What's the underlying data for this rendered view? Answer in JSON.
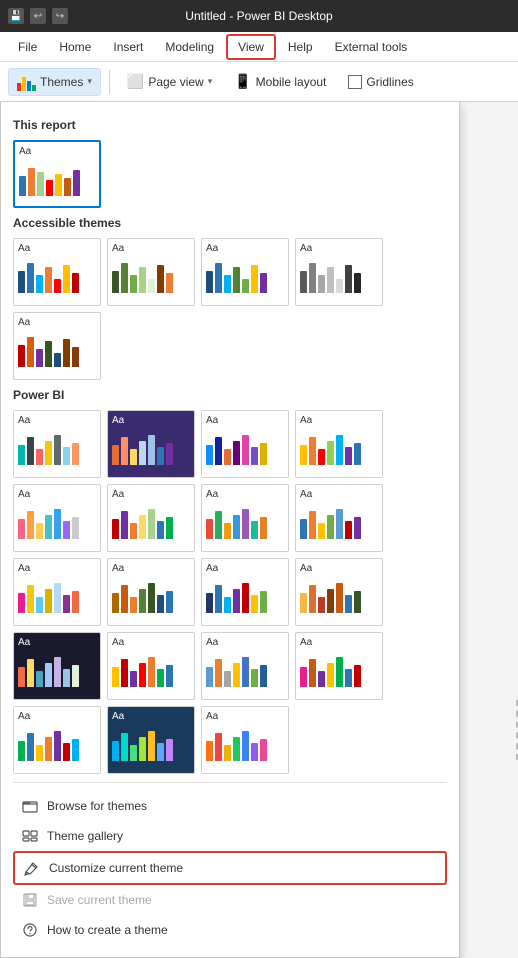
{
  "titleBar": {
    "title": "Untitled - Power BI Desktop"
  },
  "menuBar": {
    "items": [
      "File",
      "Home",
      "Insert",
      "Modeling",
      "View",
      "Help",
      "External tools"
    ],
    "activeItem": "View"
  },
  "ribbon": {
    "themes": {
      "label": "Themes",
      "icon": "themes-icon"
    },
    "pageView": {
      "label": "Page view"
    },
    "mobileLayout": {
      "label": "Mobile layout"
    },
    "gridlines": {
      "label": "Gridlines"
    }
  },
  "dropdown": {
    "sections": [
      {
        "title": "This report",
        "themes": [
          {
            "id": "current",
            "label": "Aa",
            "selected": true
          }
        ]
      },
      {
        "title": "Accessible themes",
        "themes": [
          {
            "id": "a1",
            "label": "Aa"
          },
          {
            "id": "a2",
            "label": "Aa"
          },
          {
            "id": "a3",
            "label": "Aa"
          },
          {
            "id": "a4",
            "label": "Aa"
          },
          {
            "id": "a5",
            "label": "Aa"
          }
        ]
      },
      {
        "title": "Power BI",
        "themes": [
          {
            "id": "p1",
            "label": "Aa"
          },
          {
            "id": "p2",
            "label": "Aa",
            "dark": true
          },
          {
            "id": "p3",
            "label": "Aa"
          },
          {
            "id": "p4",
            "label": "Aa"
          },
          {
            "id": "p5",
            "label": "Aa"
          },
          {
            "id": "p6",
            "label": "Aa"
          },
          {
            "id": "p7",
            "label": "Aa"
          },
          {
            "id": "p8",
            "label": "Aa"
          },
          {
            "id": "p9",
            "label": "Aa"
          },
          {
            "id": "p10",
            "label": "Aa"
          },
          {
            "id": "p11",
            "label": "Aa"
          },
          {
            "id": "p12",
            "label": "Aa"
          },
          {
            "id": "p13",
            "label": "Aa",
            "dark2": true
          },
          {
            "id": "p14",
            "label": "Aa"
          },
          {
            "id": "p15",
            "label": "Aa"
          },
          {
            "id": "p16",
            "label": "Aa"
          },
          {
            "id": "p17",
            "label": "Aa"
          },
          {
            "id": "p18",
            "label": "Aa",
            "dark3": true
          },
          {
            "id": "p19",
            "label": "Aa"
          }
        ]
      }
    ],
    "bottomMenu": [
      {
        "id": "browse",
        "label": "Browse for themes",
        "icon": "folder-icon",
        "disabled": false,
        "highlighted": false
      },
      {
        "id": "gallery",
        "label": "Theme gallery",
        "icon": "gallery-icon",
        "disabled": false,
        "highlighted": false
      },
      {
        "id": "customize",
        "label": "Customize current theme",
        "icon": "paint-icon",
        "disabled": false,
        "highlighted": true
      },
      {
        "id": "save",
        "label": "Save current theme",
        "icon": "save-icon",
        "disabled": true,
        "highlighted": false
      },
      {
        "id": "howto",
        "label": "How to create a theme",
        "icon": "help-circle-icon",
        "disabled": false,
        "highlighted": false
      }
    ]
  }
}
